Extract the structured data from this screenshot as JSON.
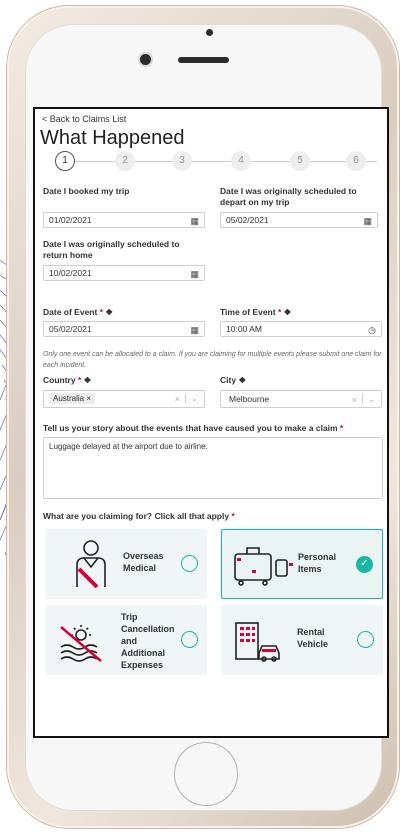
{
  "nav": {
    "back": "< Back to Claims List"
  },
  "page": {
    "title": "What Happened"
  },
  "steps": [
    {
      "num": "1",
      "active": true
    },
    {
      "num": "2",
      "active": false
    },
    {
      "num": "3",
      "active": false
    },
    {
      "num": "4",
      "active": false
    },
    {
      "num": "5",
      "active": false
    },
    {
      "num": "6",
      "active": false
    }
  ],
  "dates": {
    "booked_label": "Date I booked my trip",
    "booked_value": "01/02/2021",
    "depart_label": "Date I was originally scheduled to depart on my trip",
    "depart_value": "05/02/2021",
    "return_label": "Date I was originally scheduled to return home",
    "return_value": "10/02/2021"
  },
  "event": {
    "date_label": "Date of Event",
    "date_value": "05/02/2021",
    "time_label": "Time of Event",
    "time_value": "10:00 AM",
    "note": "Only one event can be allocated to a claim. If you are claiming for multiple events please submit one claim for each incident.",
    "country_label": "Country",
    "country_value": "Australia",
    "city_label": "City",
    "city_value": "Melbourne"
  },
  "story": {
    "label": "Tell us your story about the events that have caused you to make a claim",
    "value": "Luggage delayed at the airport due to airline."
  },
  "claiming": {
    "label": "What are you claiming for? Click all that apply",
    "options": [
      {
        "lines": [
          "Overseas",
          "Medical"
        ],
        "selected": false,
        "icon": "person-injured-icon"
      },
      {
        "lines": [
          "Personal",
          "Items"
        ],
        "selected": true,
        "icon": "luggage-icon"
      },
      {
        "lines": [
          "Trip",
          "Cancellation",
          "and",
          "Additional",
          "Expenses"
        ],
        "selected": false,
        "icon": "beach-cancel-icon"
      },
      {
        "lines": [
          "Rental",
          "Vehicle"
        ],
        "selected": false,
        "icon": "building-car-icon"
      }
    ]
  },
  "colors": {
    "accent": "#1bb7a4",
    "required": "#d6003a"
  }
}
